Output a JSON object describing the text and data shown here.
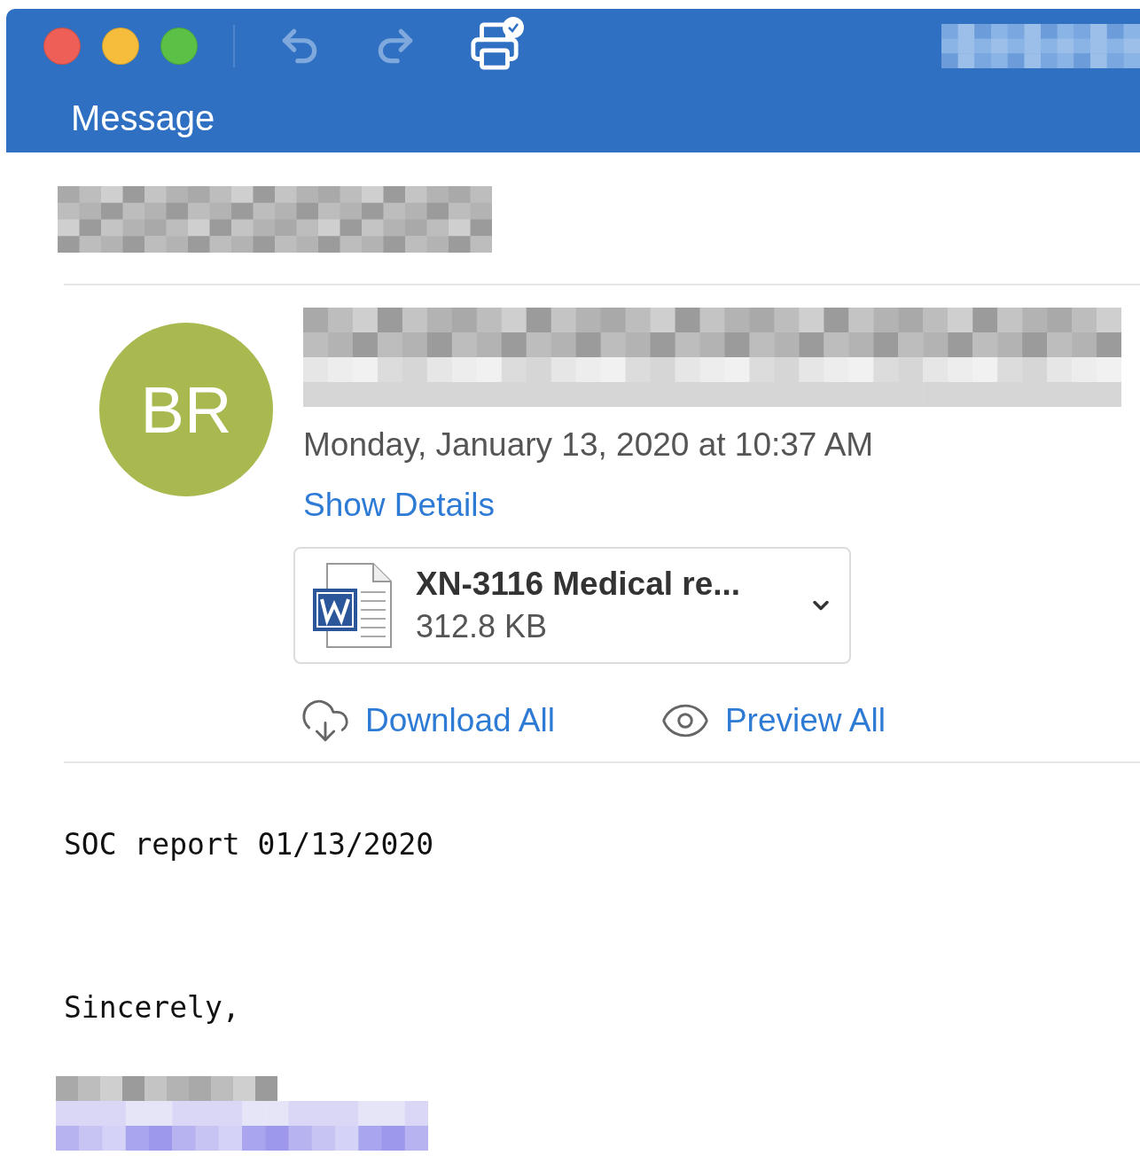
{
  "window": {
    "controls": [
      {
        "kind": "close"
      },
      {
        "kind": "minimize"
      },
      {
        "kind": "zoom"
      }
    ]
  },
  "toolbar": {
    "buttons": [
      {
        "kind": "undo",
        "disabled": true
      },
      {
        "kind": "redo",
        "disabled": true
      },
      {
        "kind": "print",
        "disabled": false
      }
    ]
  },
  "tabs": [
    {
      "label": "Message",
      "selected": true
    }
  ],
  "message": {
    "sender_initials": "BR",
    "date": "Monday, January 13, 2020 at 10:37 AM",
    "show_details": "Show Details",
    "attachment": {
      "name": "XN-3116 Medical re...",
      "size": "312.8 KB"
    },
    "actions": [
      {
        "kind": "download",
        "label": "Download All"
      },
      {
        "kind": "preview",
        "label": "Preview All"
      }
    ],
    "body": [
      "SOC report 01/13/2020",
      "Sincerely,"
    ]
  }
}
